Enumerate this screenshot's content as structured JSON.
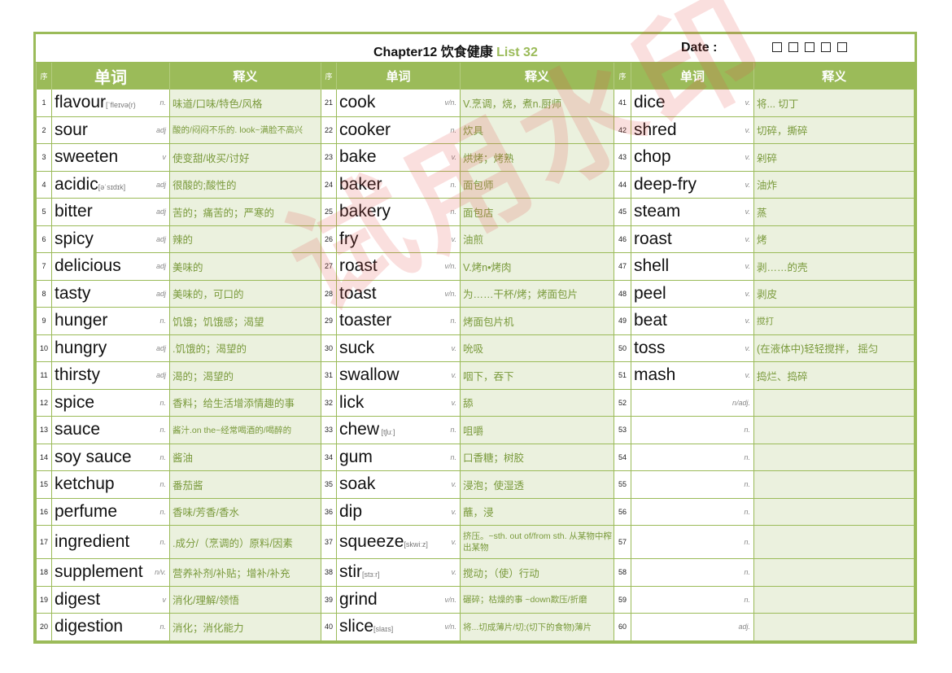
{
  "header": {
    "chapter": "Chapter12 饮食健康",
    "list": "List 32",
    "date_label": "Date :",
    "date_boxes": 5
  },
  "columns": {
    "seq": "序",
    "word": "单词",
    "definition": "释义"
  },
  "watermark": "试用水印",
  "colors": {
    "accent": "#9bbb59",
    "def_bg": "#ebf1de",
    "def_text": "#7a9a3c",
    "watermark": "#e65046"
  },
  "entries": [
    {
      "n": "1",
      "word": "flavour",
      "ph": "[ˈfleɪvə(r)",
      "pos": "n.",
      "def": "味道/口味/特色/风格"
    },
    {
      "n": "2",
      "word": "sour",
      "ph": "",
      "pos": "adj",
      "def": "酸的/闷闷不乐的. look~满脸不高兴",
      "style": "small"
    },
    {
      "n": "3",
      "word": "sweeten",
      "ph": "",
      "pos": "v",
      "def": "使变甜/收买/讨好"
    },
    {
      "n": "4",
      "word": "acidic",
      "ph": "[əˈsɪdɪk]",
      "pos": "adj",
      "def": "很酸的;酸性的"
    },
    {
      "n": "5",
      "word": "bitter",
      "ph": "",
      "pos": "adj",
      "def": "苦的；痛苦的；严寒的"
    },
    {
      "n": "6",
      "word": "spicy",
      "ph": "",
      "pos": "adj",
      "def": "辣的"
    },
    {
      "n": "7",
      "word": "delicious",
      "ph": "",
      "pos": "adj",
      "def": "美味的"
    },
    {
      "n": "8",
      "word": "tasty",
      "ph": "",
      "pos": "adj",
      "def": "美味的，可口的"
    },
    {
      "n": "9",
      "word": "hunger",
      "ph": "",
      "pos": "n.",
      "def": "饥饿；饥饿感；渴望"
    },
    {
      "n": "10",
      "word": "hungry",
      "ph": "",
      "pos": "adj",
      "def": ".饥饿的；渴望的"
    },
    {
      "n": "11",
      "word": "thirsty",
      "ph": "",
      "pos": "adj",
      "def": "渴的；渴望的"
    },
    {
      "n": "12",
      "word": "spice",
      "ph": "",
      "pos": "n.",
      "def": "香料；给生活增添情趣的事"
    },
    {
      "n": "13",
      "word": "sauce",
      "ph": "",
      "pos": "n.",
      "def": "酱汁.on the~经常喝酒的/喝醉的",
      "style": "small"
    },
    {
      "n": "14",
      "word": "soy sauce",
      "ph": "",
      "pos": "n.",
      "def": "酱油"
    },
    {
      "n": "15",
      "word": "ketchup",
      "ph": "",
      "pos": "n.",
      "def": "番茄酱"
    },
    {
      "n": "16",
      "word": "perfume",
      "ph": "",
      "pos": "n.",
      "def": "香味/芳香/香水"
    },
    {
      "n": "17",
      "word": "ingredient",
      "ph": "",
      "pos": "n.",
      "def": ".成分/（烹调的）原料/因素"
    },
    {
      "n": "18",
      "word": "supplement",
      "ph": "",
      "pos": "n/v.",
      "def": "营养补剂/补贴；增补/补充"
    },
    {
      "n": "19",
      "word": "digest",
      "ph": "",
      "pos": "v",
      "def": "消化/理解/领悟"
    },
    {
      "n": "20",
      "word": "digestion",
      "ph": "",
      "pos": "n.",
      "def": "消化；消化能力"
    },
    {
      "n": "21",
      "word": "cook",
      "ph": "",
      "pos": "v/n.",
      "def": "V.烹调，烧，煮n.厨师"
    },
    {
      "n": "22",
      "word": "cooker",
      "ph": "",
      "pos": "n.",
      "def": "炊具"
    },
    {
      "n": "23",
      "word": "bake",
      "ph": "",
      "pos": "v.",
      "def": "烘烤；烤熟"
    },
    {
      "n": "24",
      "word": "baker",
      "ph": "",
      "pos": "n.",
      "def": "面包师"
    },
    {
      "n": "25",
      "word": "bakery",
      "ph": "",
      "pos": "n.",
      "def": "面包店"
    },
    {
      "n": "26",
      "word": "fry",
      "ph": "",
      "pos": "v.",
      "def": "油煎"
    },
    {
      "n": "27",
      "word": "roast",
      "ph": "",
      "pos": "v/n.",
      "def": "V.烤n•烤肉"
    },
    {
      "n": "28",
      "word": "toast",
      "ph": "",
      "pos": "v/n.",
      "def": "为……干杯/烤；烤面包片"
    },
    {
      "n": "29",
      "word": "toaster",
      "ph": "",
      "pos": "n.",
      "def": "烤面包片机"
    },
    {
      "n": "30",
      "word": "suck",
      "ph": "",
      "pos": "v.",
      "def": "吮吸"
    },
    {
      "n": "31",
      "word": "swallow",
      "ph": "",
      "pos": "v.",
      "def": "咽下，吞下"
    },
    {
      "n": "32",
      "word": "lick",
      "ph": "",
      "pos": "v.",
      "def": "舔"
    },
    {
      "n": "33",
      "word": "chew",
      "ph": " [tʃuː]",
      "pos": "n.",
      "def": "咀嚼"
    },
    {
      "n": "34",
      "word": "gum",
      "ph": "",
      "pos": "n.",
      "def": "口香糖；树胶"
    },
    {
      "n": "35",
      "word": "soak",
      "ph": "",
      "pos": "v.",
      "def": "浸泡；使湿透"
    },
    {
      "n": "36",
      "word": "dip",
      "ph": "",
      "pos": "v.",
      "def": "蘸，浸"
    },
    {
      "n": "37",
      "word": "squeeze",
      "ph": "[skwiːz]",
      "pos": "v.",
      "def": "挤压。~sth. out of/from sth. 从某物中榨出某物",
      "style": "two"
    },
    {
      "n": "38",
      "word": "stir",
      "ph": "[stɜːr]",
      "pos": "v.",
      "def": "搅动；（使）行动"
    },
    {
      "n": "39",
      "word": "grind",
      "ph": "",
      "pos": "v/n.",
      "def": "碾碎；枯燥的事 ~down欺压/折磨",
      "style": "small"
    },
    {
      "n": "40",
      "word": "slice",
      "ph": "[slaɪs]",
      "pos": "v/n.",
      "def": "将...切成薄片/切;(切下的食物)薄片",
      "style": "small"
    },
    {
      "n": "41",
      "word": "dice",
      "ph": "",
      "pos": "v.",
      "def": "将... 切丁"
    },
    {
      "n": "42",
      "word": "shred",
      "ph": "",
      "pos": "v.",
      "def": "切碎，撕碎"
    },
    {
      "n": "43",
      "word": "chop",
      "ph": "",
      "pos": "v.",
      "def": "剁碎"
    },
    {
      "n": "44",
      "word": "deep-fry",
      "ph": "",
      "pos": "v.",
      "def": "油炸"
    },
    {
      "n": "45",
      "word": "steam",
      "ph": "",
      "pos": "v.",
      "def": "蒸"
    },
    {
      "n": "46",
      "word": "roast",
      "ph": "",
      "pos": "v.",
      "def": "烤"
    },
    {
      "n": "47",
      "word": "shell",
      "ph": "",
      "pos": "v.",
      "def": "剥……的壳"
    },
    {
      "n": "48",
      "word": "peel",
      "ph": "",
      "pos": "v.",
      "def": "剥皮"
    },
    {
      "n": "49",
      "word": "beat",
      "ph": "",
      "pos": "v.",
      "def": "搅打",
      "style": "small"
    },
    {
      "n": "50",
      "word": "toss",
      "ph": "",
      "pos": "v.",
      "def": "(在液体中)轻轻搅拌， 摇匀"
    },
    {
      "n": "51",
      "word": "mash",
      "ph": "",
      "pos": "v.",
      "def": "捣烂、捣碎"
    },
    {
      "n": "52",
      "word": "",
      "ph": "",
      "pos": "n/adj.",
      "def": ""
    },
    {
      "n": "53",
      "word": "",
      "ph": "",
      "pos": "n.",
      "def": ""
    },
    {
      "n": "54",
      "word": "",
      "ph": "",
      "pos": "n.",
      "def": ""
    },
    {
      "n": "55",
      "word": "",
      "ph": "",
      "pos": "n.",
      "def": ""
    },
    {
      "n": "56",
      "word": "",
      "ph": "",
      "pos": "n.",
      "def": ""
    },
    {
      "n": "57",
      "word": "",
      "ph": "",
      "pos": "n.",
      "def": ""
    },
    {
      "n": "58",
      "word": "",
      "ph": "",
      "pos": "n.",
      "def": ""
    },
    {
      "n": "59",
      "word": "",
      "ph": "",
      "pos": "n.",
      "def": ""
    },
    {
      "n": "60",
      "word": "",
      "ph": "",
      "pos": "adj.",
      "def": ""
    }
  ]
}
